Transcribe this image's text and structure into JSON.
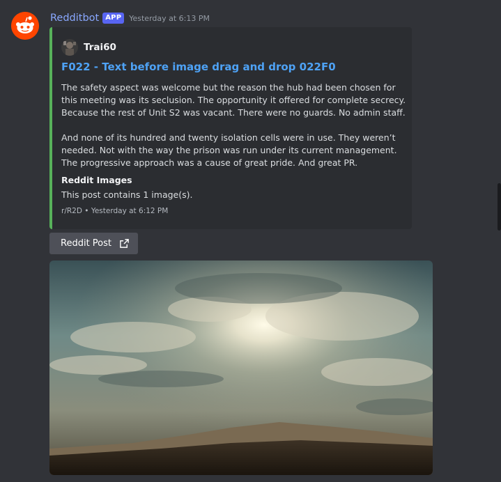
{
  "message": {
    "username": "Redditbot",
    "badge": "APP",
    "timestamp": "Yesterday at 6:13 PM"
  },
  "embed": {
    "accent_color": "#57b25a",
    "author": "Trai60",
    "title": "F022 - Text before image drag and drop 022F0",
    "paragraph1": "The safety aspect was welcome but the reason the hub had been chosen for this meeting was its seclusion. The opportunity it offered for complete secrecy. Because the rest of Unit S2 was vacant. There were no guards. No admin staff.",
    "paragraph2": "And none of its hundred and twenty isolation cells were in use. They weren’t needed. Not with the way the prison was run under its current management. The progressive approach was a cause of great pride. And great PR.",
    "field_name": "Reddit Images",
    "field_value": "This post contains 1 image(s).",
    "footer_subreddit": "r/R2D",
    "footer_separator": "•",
    "footer_time": "Yesterday at 6:12 PM"
  },
  "button": {
    "label": "Reddit Post",
    "icon": "external-link-icon"
  },
  "attachment": {
    "description": "image"
  }
}
